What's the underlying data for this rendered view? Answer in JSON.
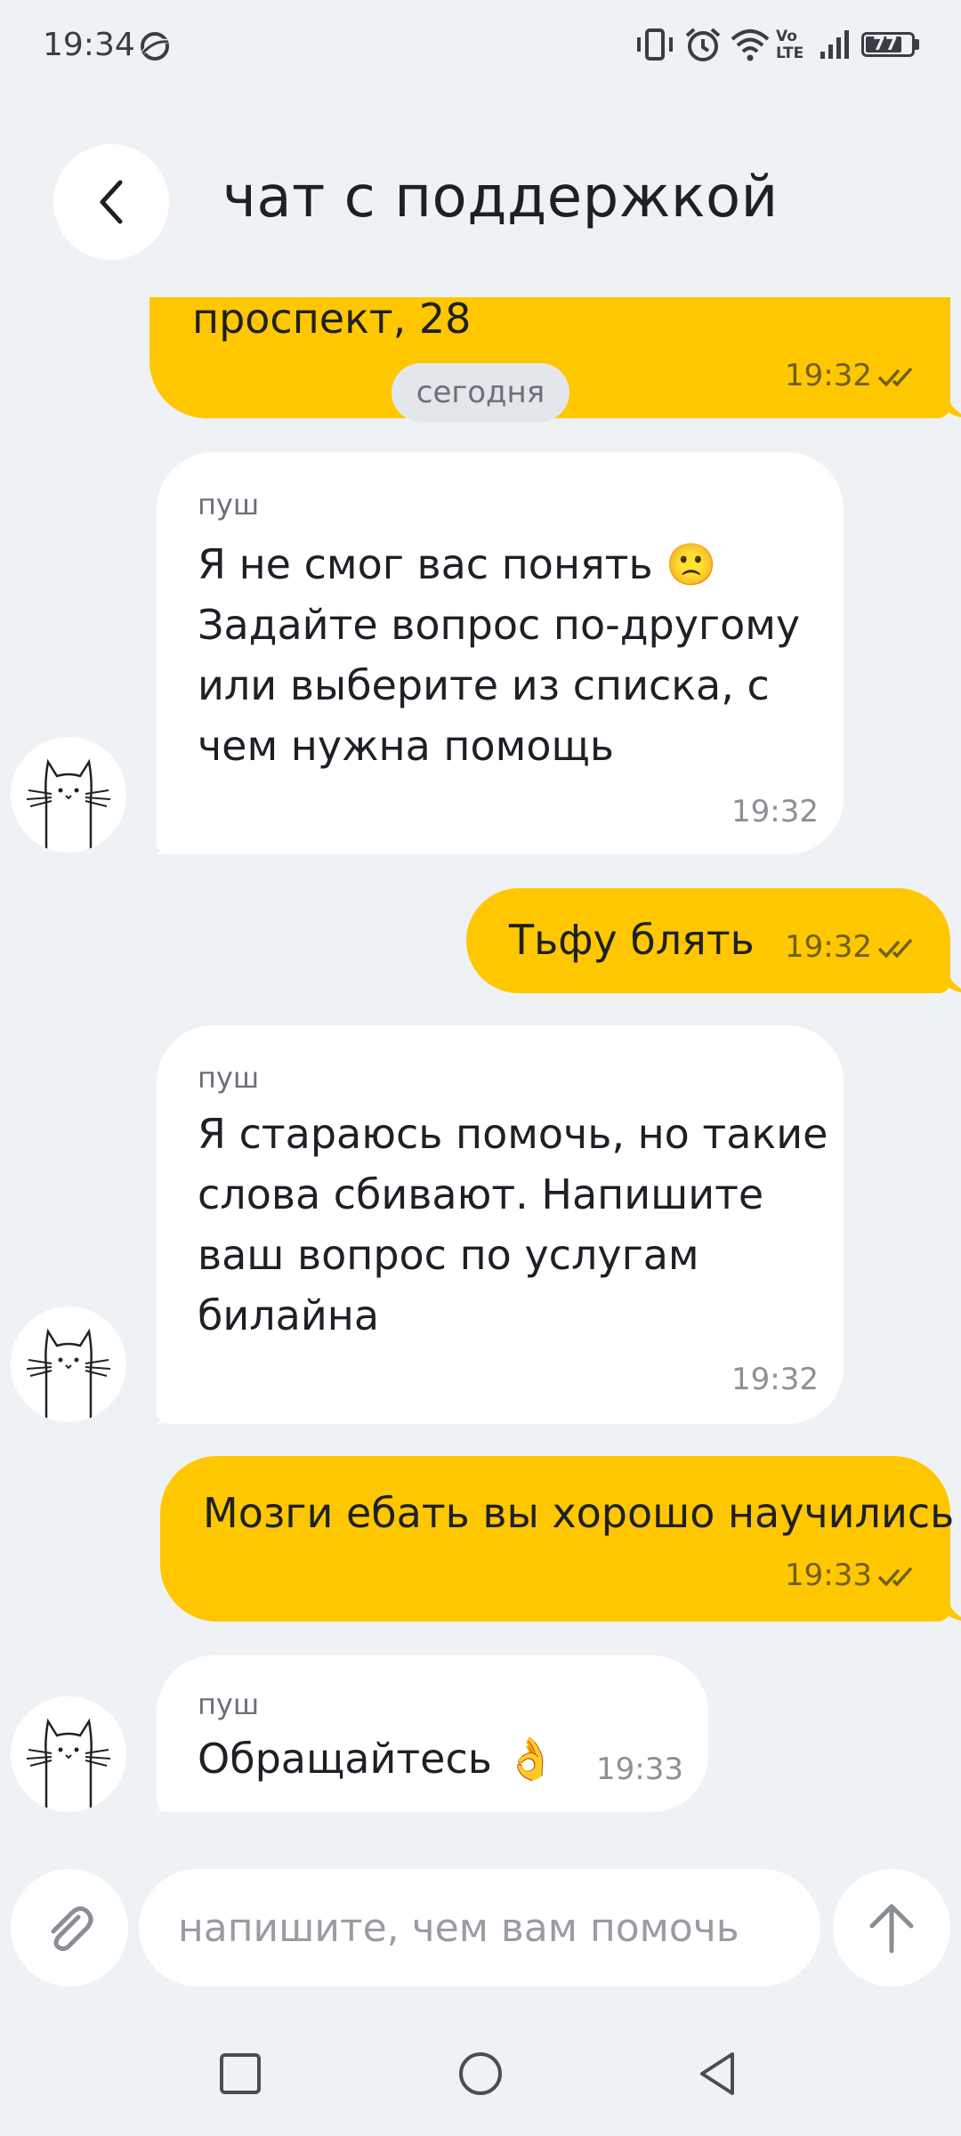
{
  "status_bar": {
    "time": "19:34",
    "network": "Vo LTE",
    "battery": "77",
    "icons": [
      "vibrate-icon",
      "alarm-icon",
      "wifi-icon",
      "volte-icon",
      "signal-icon",
      "battery-icon"
    ]
  },
  "header": {
    "back_icon": "chevron-left-icon",
    "title": "чат с поддержкой"
  },
  "chat": {
    "partial_message": {
      "text": "проспект, 28",
      "time": "19:32"
    },
    "date_separator": "сегодня",
    "messages": [
      {
        "direction": "incoming",
        "sender": "пуш",
        "lines": [
          "Я не смог вас понять 🙁",
          "Задайте вопрос по-другому",
          "или выберите из списка, с",
          "чем нужна помощь"
        ],
        "time": "19:32"
      },
      {
        "direction": "outgoing",
        "text": "Тьфу блять",
        "time": "19:32"
      },
      {
        "direction": "incoming",
        "sender": "пуш",
        "lines": [
          "Я стараюсь помочь, но такие",
          "слова сбивают. Напишите",
          "ваш вопрос по услугам",
          "билайна"
        ],
        "time": "19:32"
      },
      {
        "direction": "outgoing",
        "text": "Мозги ебать вы хорошо научились",
        "time": "19:33"
      },
      {
        "direction": "incoming",
        "sender": "пуш",
        "text": "Обращайтесь 👌",
        "time": "19:33"
      }
    ]
  },
  "composer": {
    "placeholder": "напишите, чем вам помочь",
    "value": "",
    "attach_icon": "paperclip-icon",
    "send_icon": "arrow-up-icon"
  },
  "nav_bar": {
    "buttons": [
      "recents-square-icon",
      "home-circle-icon",
      "back-triangle-icon"
    ]
  },
  "colors": {
    "background": "#eff2f5",
    "outgoing_bubble": "#ffc700",
    "incoming_bubble": "#ffffff",
    "text": "#1e2026",
    "muted": "#8f8f95"
  }
}
